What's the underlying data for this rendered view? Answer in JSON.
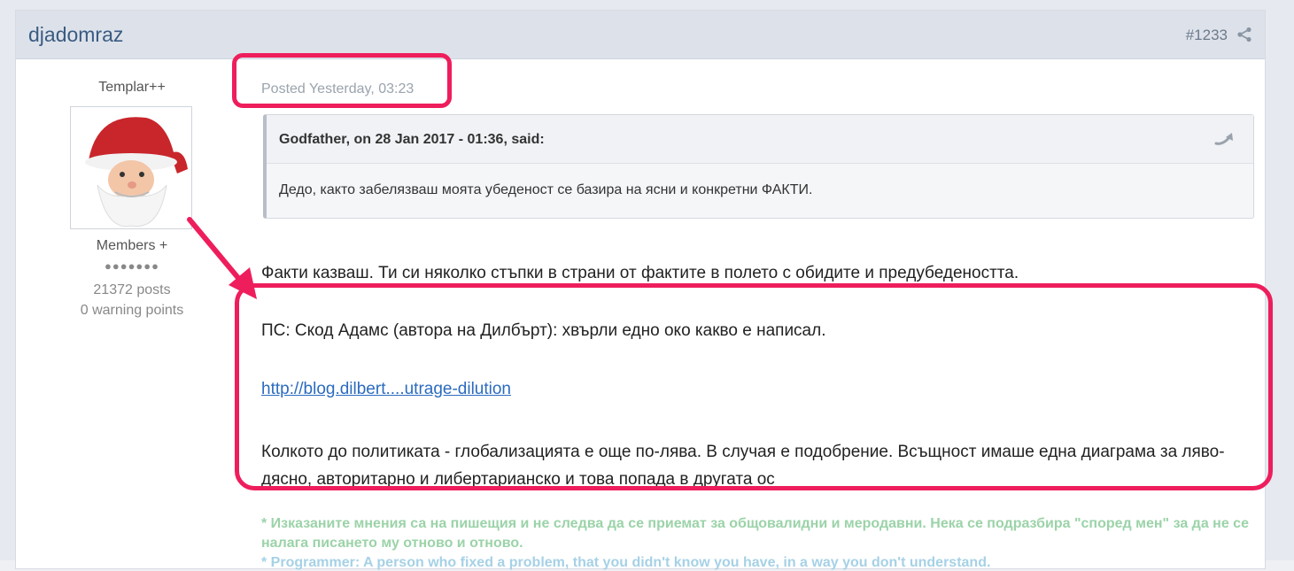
{
  "post": {
    "author": "djadomraz",
    "number": "#1233",
    "share_icon": "share-icon",
    "user_title": "Templar++",
    "group": "Members +",
    "pips": "●●●●●●●",
    "post_count": "21372 posts",
    "warning_points": "0 warning points",
    "posted": "Posted Yesterday, 03:23",
    "quote": {
      "cite": "Godfather, on 28 Jan 2017 - 01:36, said:",
      "text": "Дедо, както забелязваш моята убеденост се базира на ясни и конкретни ФАКТИ.",
      "icon": "quote-jump-icon"
    },
    "paragraph1": "Факти казваш. Ти си няколко стъпки в страни от фактите в полето с обидите и предубедеността.",
    "paragraph2": "ПС: Скод Адамс (автора на Дилбърт): хвърли едно око какво е написал.",
    "link_text": "http://blog.dilbert....utrage-dilution",
    "paragraph3": "Колкото до политиката - глобализацията е още по-лява. В случая е подобрение. Всъщност имаше една диаграма за ляво-дясно, авторитарно и либертарианско и това попада в другата ос",
    "signature1": "* Изказаните мнения са на пишещия и не следва да се приемат за общовалидни и меродавни. Нека се подразбира \"според мен\" за да не се налага писането му отново и отново.",
    "signature2": "* Programmer: A person who fixed a problem, that you didn't know you have, in a way you don't understand."
  },
  "colors": {
    "highlight": "#ee1e5c",
    "link": "#2b6bbf",
    "signature_green": "#9bd3a8",
    "signature_blue": "#a6d1e6"
  }
}
